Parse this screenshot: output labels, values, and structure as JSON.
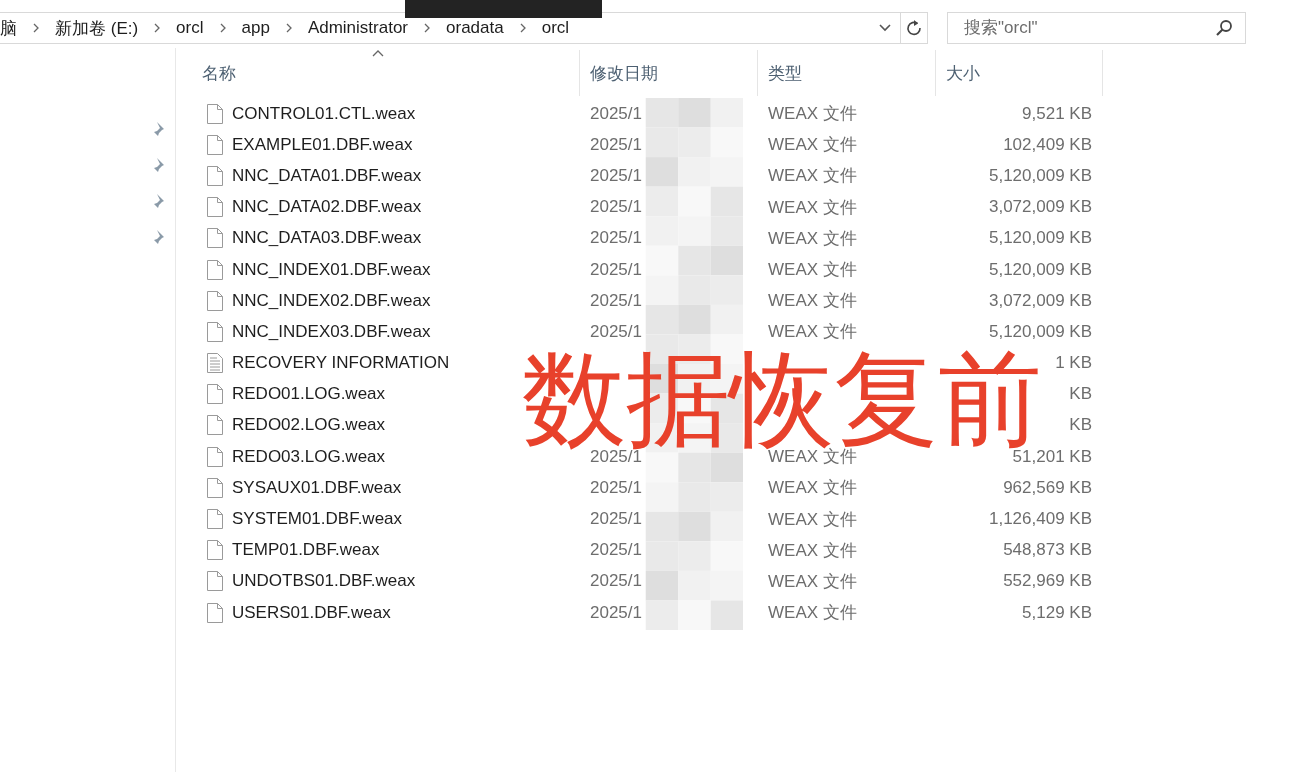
{
  "breadcrumb": [
    "脑",
    "新加卷 (E:)",
    "orcl",
    "app",
    "Administrator",
    "oradata",
    "orcl"
  ],
  "search": {
    "placeholder": "搜索\"orcl\""
  },
  "columns": [
    {
      "label": "名称",
      "sorted": true
    },
    {
      "label": "修改日期",
      "sorted": false
    },
    {
      "label": "类型",
      "sorted": false
    },
    {
      "label": "大小",
      "sorted": false
    }
  ],
  "rows": [
    {
      "kind": "file",
      "name": "CONTROL01.CTL.weax",
      "date": "2025/1",
      "type": "WEAX 文件",
      "size": "9,521 KB"
    },
    {
      "kind": "file",
      "name": "EXAMPLE01.DBF.weax",
      "date": "2025/1",
      "type": "WEAX 文件",
      "size": "102,409 KB"
    },
    {
      "kind": "file",
      "name": "NNC_DATA01.DBF.weax",
      "date": "2025/1",
      "type": "WEAX 文件",
      "size": "5,120,009 KB"
    },
    {
      "kind": "file",
      "name": "NNC_DATA02.DBF.weax",
      "date": "2025/1",
      "type": "WEAX 文件",
      "size": "3,072,009 KB"
    },
    {
      "kind": "file",
      "name": "NNC_DATA03.DBF.weax",
      "date": "2025/1",
      "type": "WEAX 文件",
      "size": "5,120,009 KB"
    },
    {
      "kind": "file",
      "name": "NNC_INDEX01.DBF.weax",
      "date": "2025/1",
      "type": "WEAX 文件",
      "size": "5,120,009 KB"
    },
    {
      "kind": "file",
      "name": "NNC_INDEX02.DBF.weax",
      "date": "2025/1",
      "type": "WEAX 文件",
      "size": "3,072,009 KB"
    },
    {
      "kind": "file",
      "name": "NNC_INDEX03.DBF.weax",
      "date": "2025/1",
      "type": "WEAX 文件",
      "size": "5,120,009 KB"
    },
    {
      "kind": "text",
      "name": "RECOVERY INFORMATION",
      "size": "1 KB"
    },
    {
      "kind": "file",
      "name": "REDO01.LOG.weax",
      "size": "KB"
    },
    {
      "kind": "file",
      "name": "REDO02.LOG.weax",
      "size": "KB"
    },
    {
      "kind": "file",
      "name": "REDO03.LOG.weax",
      "date": "2025/1",
      "type": "WEAX 文件",
      "size": "51,201 KB"
    },
    {
      "kind": "file",
      "name": "SYSAUX01.DBF.weax",
      "date": "2025/1",
      "type": "WEAX 文件",
      "size": "962,569 KB"
    },
    {
      "kind": "file",
      "name": "SYSTEM01.DBF.weax",
      "date": "2025/1",
      "type": "WEAX 文件",
      "size": "1,126,409 KB"
    },
    {
      "kind": "file",
      "name": "TEMP01.DBF.weax",
      "date": "2025/1",
      "type": "WEAX 文件",
      "size": "548,873 KB"
    },
    {
      "kind": "file",
      "name": "UNDOTBS01.DBF.weax",
      "date": "2025/1",
      "type": "WEAX 文件",
      "size": "552,969 KB"
    },
    {
      "kind": "file",
      "name": "USERS01.DBF.weax",
      "date": "2025/1",
      "type": "WEAX 文件",
      "size": "5,129 KB"
    }
  ],
  "overlay_label": "数据恢复前"
}
